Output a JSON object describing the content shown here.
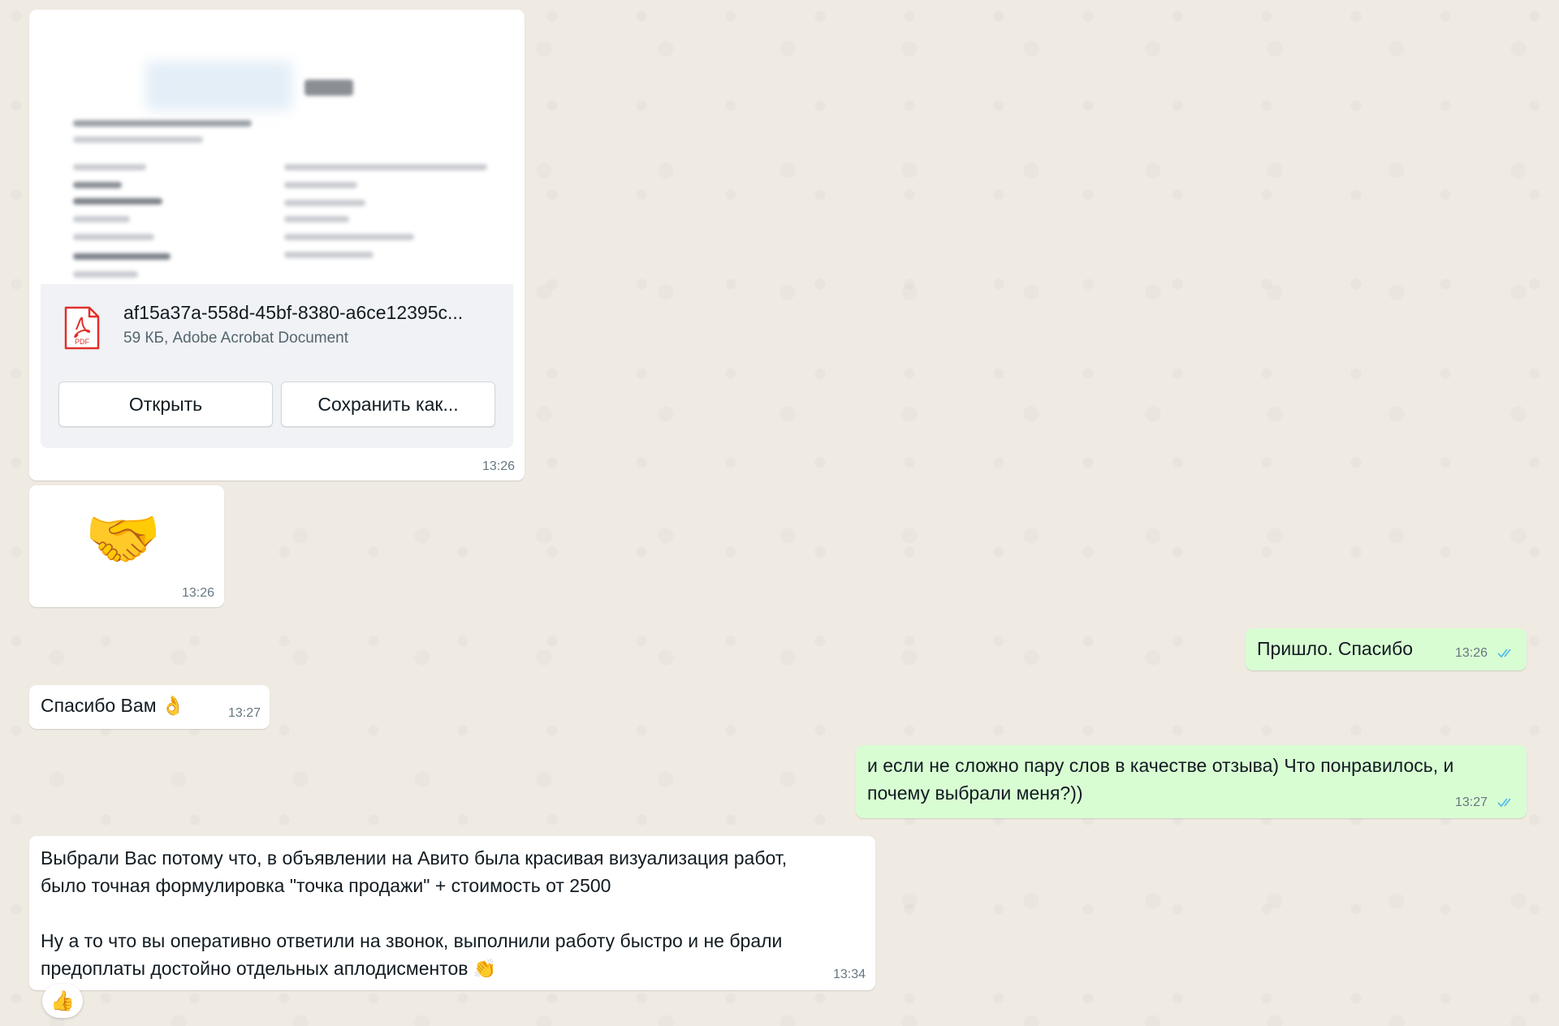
{
  "messages": {
    "document": {
      "file_name": "af15a37a-558d-45bf-8380-a6ce12395c...",
      "file_info": "59 КБ, Adobe Acrobat Document",
      "file_type_badge": "PDF",
      "open_label": "Открыть",
      "save_as_label": "Сохранить как...",
      "time": "13:26"
    },
    "emoji": {
      "symbol": "🤝",
      "time": "13:26"
    },
    "out_1": {
      "text": "Пришло. Спасибо",
      "time": "13:26",
      "status_icon": "double-check-read"
    },
    "in_1": {
      "text": "Спасибо Вам 👌",
      "time": "13:27"
    },
    "out_2": {
      "text": "и если не сложно пару слов в качестве отзыва) Что понравилось, и\nпочему выбрали меня?))",
      "time": "13:27",
      "status_icon": "double-check-read"
    },
    "in_2": {
      "text": "Выбрали Вас потому что, в объявлении на Авито была красивая визуализация работ,\nбыло точная формулировка \"точка продажи\" + стоимость от 2500\n\nНу а то что вы оперативно ответили на звонок, выполнили работу быстро и не брали\nпредоплаты достойно отдельных аплодисментов 👏",
      "time": "13:34",
      "reaction": "👍"
    }
  },
  "colors": {
    "chat_background": "#efeae2",
    "incoming_bubble": "#ffffff",
    "outgoing_bubble": "#d9fdd3",
    "read_ticks": "#53bdeb",
    "pdf_red": "#e0312b"
  }
}
